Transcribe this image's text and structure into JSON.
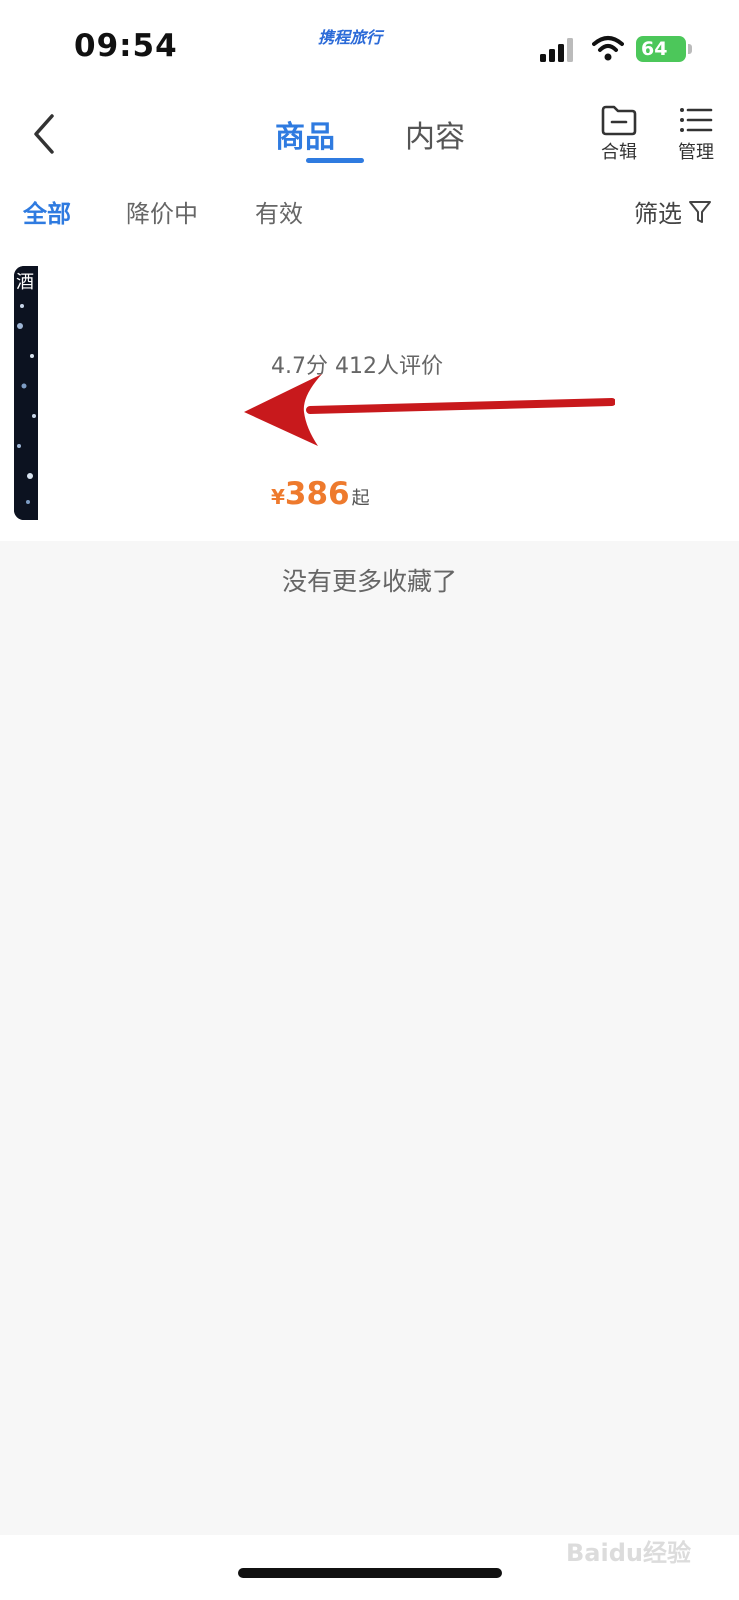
{
  "status_bar": {
    "time": "09:54",
    "brand": "携程旅行",
    "battery": "64"
  },
  "nav": {
    "tabs": [
      {
        "label": "商品",
        "active": true
      },
      {
        "label": "内容",
        "active": false
      }
    ],
    "collection_label": "合辑",
    "manage_label": "管理"
  },
  "filters": {
    "items": [
      {
        "label": "全部",
        "active": true
      },
      {
        "label": "降价中",
        "active": false
      },
      {
        "label": "有效",
        "active": false
      }
    ],
    "screen_label": "筛选"
  },
  "item": {
    "thumb_label": "酒",
    "rating": "4.7分 412人评价",
    "price_currency": "¥",
    "price_value": "386",
    "price_suffix": "起"
  },
  "footer": {
    "no_more": "没有更多收藏了"
  },
  "watermark": "Baidu经验",
  "colors": {
    "accent": "#2f7be0",
    "price": "#ee7a2d",
    "arrow": "#c8191c",
    "background": "#f7f7f7"
  }
}
